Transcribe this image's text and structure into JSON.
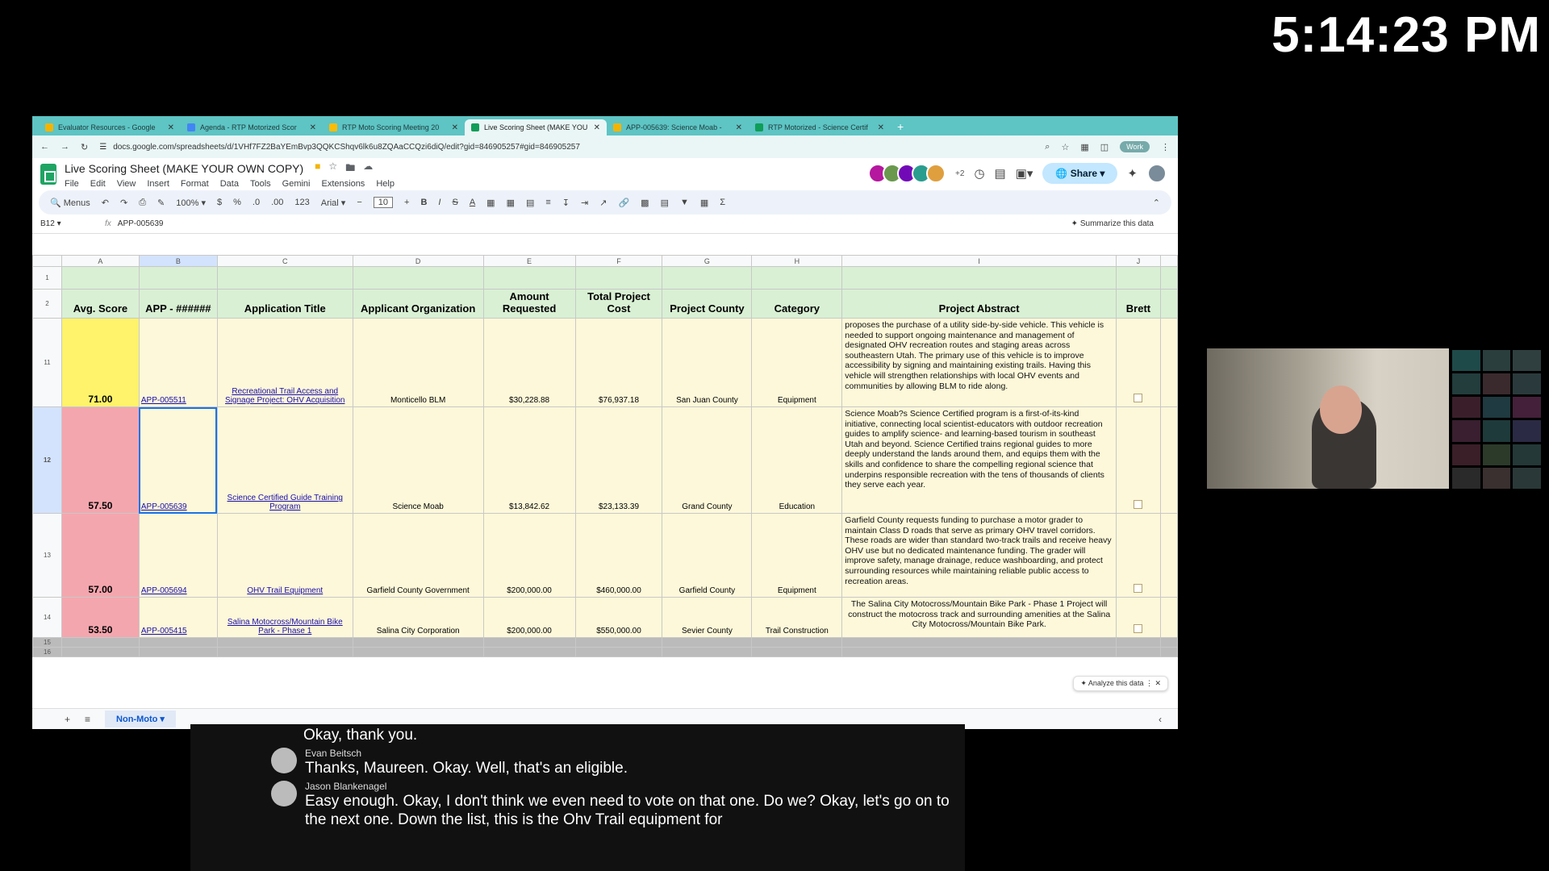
{
  "clock": "5:14:23 PM",
  "browser": {
    "tabs": [
      {
        "title": "Evaluator Resources - Google",
        "color": "#f4b400",
        "active": false
      },
      {
        "title": "Agenda - RTP Motorized Scor",
        "color": "#4285f4",
        "active": false
      },
      {
        "title": "RTP Moto Scoring Meeting 20",
        "color": "#fbbc04",
        "active": false
      },
      {
        "title": "Live Scoring Sheet (MAKE YOU",
        "color": "#0f9d58",
        "active": true
      },
      {
        "title": "APP-005639: Science Moab -",
        "color": "#f4b400",
        "active": false
      },
      {
        "title": "RTP Motorized - Science Certif",
        "color": "#0f9d58",
        "active": false
      }
    ],
    "url": "docs.google.com/spreadsheets/d/1VHf7FZ2BaYEmBvp3QQKCShqv6lk6u8ZQAaCCQzi6diQ/edit?gid=846905257#gid=846905257",
    "profile_label": "Work"
  },
  "sheet": {
    "doc_title": "Live Scoring Sheet (MAKE YOUR OWN COPY)",
    "menu": [
      "File",
      "Edit",
      "View",
      "Insert",
      "Format",
      "Data",
      "Tools",
      "Gemini",
      "Extensions",
      "Help"
    ],
    "extra_collaborators": "+2",
    "share_label": "Share",
    "toolbar": {
      "menus_label": "Menus",
      "zoom": "100%",
      "currency": "$",
      "percent": "%",
      "dec_decrease": ".0",
      "dec_increase": ".00",
      "number_format": "123",
      "font": "Arial",
      "font_size": "10"
    },
    "namebox": "B12",
    "formula": "APP-005639",
    "summarize_label": "Summarize this data",
    "analyze_label": "Analyze this data",
    "active_sheet": "Non-Moto",
    "columns": [
      "A",
      "B",
      "C",
      "D",
      "E",
      "F",
      "G",
      "H",
      "I",
      "J"
    ],
    "headers": [
      "Avg. Score",
      "APP - ######",
      "Application Title",
      "Applicant Organization",
      "Amount Requested",
      "Total Project Cost",
      "Project County",
      "Category",
      "Project Abstract",
      "Brett"
    ],
    "row_numbers": {
      "header_top": "1",
      "header": "2",
      "footer1": "15",
      "footer2": "16"
    },
    "rows": [
      {
        "num": "11",
        "score": "71.00",
        "score_color": "#fef36a",
        "app": "APP-005511",
        "title": "Recreational Trail Access and Signage Project: OHV Acquisition",
        "org": "Monticello BLM",
        "amount": "$30,228.88",
        "total": "$76,937.18",
        "county": "San Juan County",
        "category": "Equipment",
        "abstract": "proposes the purchase of a utility side-by-side vehicle. This vehicle is needed to support ongoing maintenance and management of designated OHV recreation routes and staging areas across southeastern Utah. The primary use of this vehicle is to improve accessibility by signing and maintaining existing trails. Having this vehicle will strengthen relationships with local OHV events and communities by allowing BLM to ride along."
      },
      {
        "num": "12",
        "score": "57.50",
        "score_color": "#f4a6ae",
        "app": "APP-005639",
        "title": "Science Certified Guide Training Program",
        "org": "Science Moab",
        "amount": "$13,842.62",
        "total": "$23,133.39",
        "county": "Grand County",
        "category": "Education",
        "abstract": "Science Moab?s Science Certified program is a first-of-its-kind initiative, connecting local scientist-educators with outdoor recreation guides to amplify science- and learning-based tourism in southeast Utah and beyond. Science Certified trains regional guides to more deeply understand the lands around them, and equips them with the skills and confidence to share the compelling regional science that underpins responsible recreation with the tens of thousands of clients they serve each year."
      },
      {
        "num": "13",
        "score": "57.00",
        "score_color": "#f4a6ae",
        "app": "APP-005694",
        "title": "OHV Trail Equipment",
        "org": "Garfield County Government",
        "amount": "$200,000.00",
        "total": "$460,000.00",
        "county": "Garfield County",
        "category": "Equipment",
        "abstract": "Garfield County requests funding to purchase a motor grader to maintain Class D roads that serve as primary OHV travel corridors. These roads are wider than standard two-track trails and receive heavy OHV use but no dedicated maintenance funding. The grader will improve safety, manage drainage, reduce washboarding, and protect surrounding resources while maintaining reliable public access to recreation areas."
      },
      {
        "num": "14",
        "score": "53.50",
        "score_color": "#f4a6ae",
        "app": "APP-005415",
        "title": "Salina Motocross/Mountain Bike Park - Phase 1",
        "org": "Salina City Corporation",
        "amount": "$200,000.00",
        "total": "$550,000.00",
        "county": "Sevier County",
        "category": "Trail Construction",
        "abstract": "The Salina City Motocross/Mountain Bike Park - Phase 1 Project will construct the motocross track and surrounding amenities at the Salina City Motocross/Mountain Bike Park."
      }
    ]
  },
  "captions": {
    "first_line": "Okay, thank you.",
    "blocks": [
      {
        "speaker": "Evan Beitsch",
        "text": "Thanks, Maureen. Okay. Well, that's an eligible."
      },
      {
        "speaker": "Jason Blankenagel",
        "text": "Easy enough. Okay, I don't think we even need to vote on that one. Do we? Okay, let's go on to the next one. Down the list, this is the Ohv Trail equipment for"
      }
    ]
  },
  "collaborator_colors": [
    "#b5179e",
    "#6a994e",
    "#7209b7",
    "#2a9d8f",
    "#e09f3e"
  ]
}
